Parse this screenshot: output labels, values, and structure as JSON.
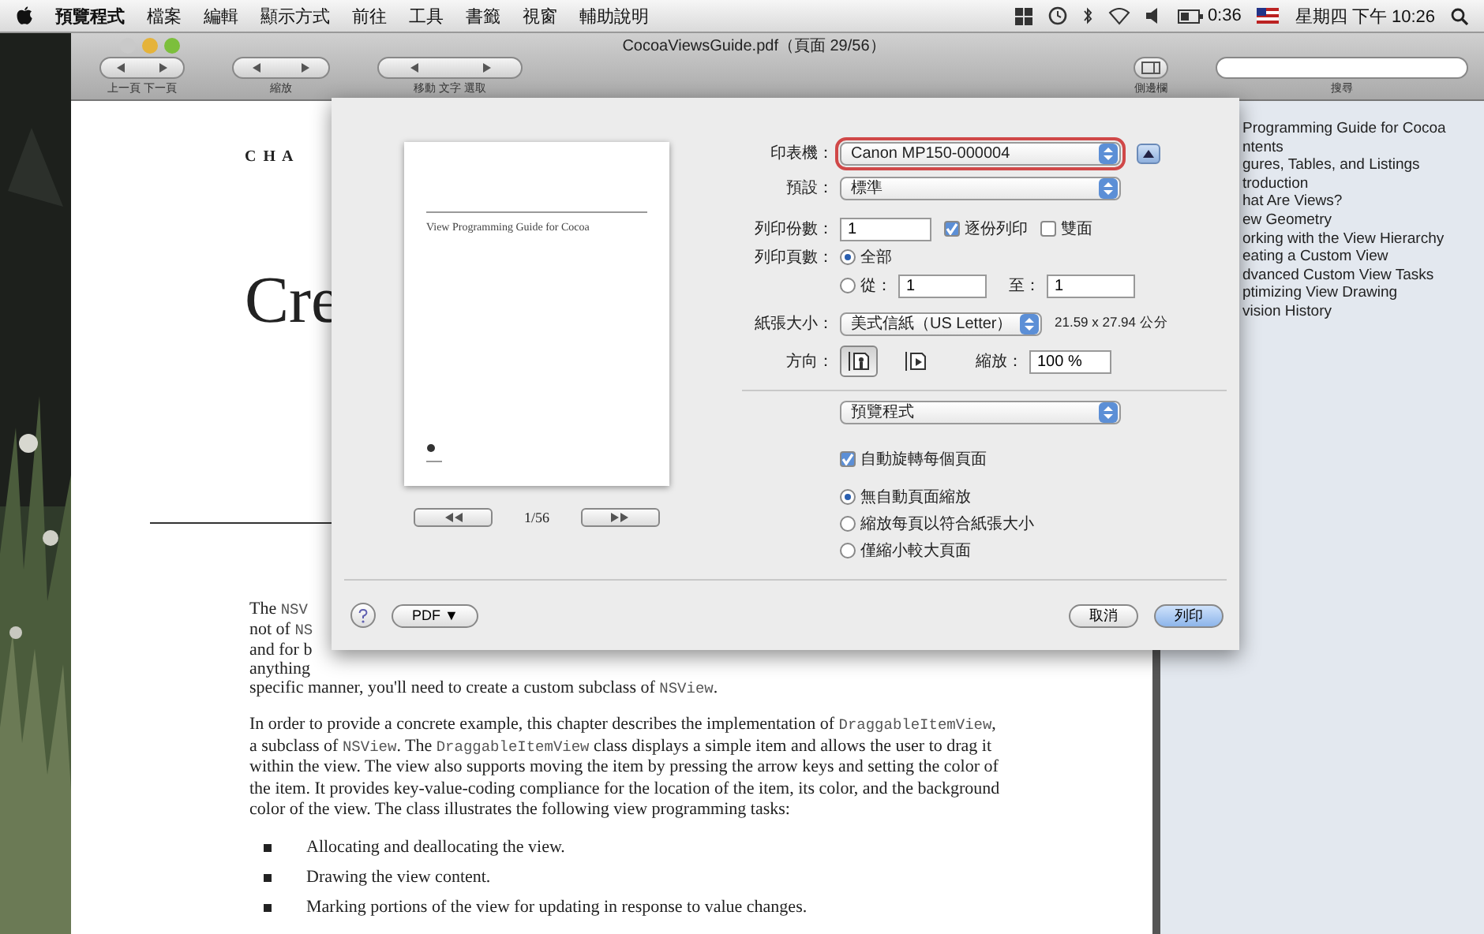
{
  "menu_bar": {
    "items": [
      "預覽程式",
      "檔案",
      "編輯",
      "顯示方式",
      "前往",
      "工具",
      "書籤",
      "視窗",
      "輔助說明"
    ],
    "battery": "0:36",
    "clock": "星期四 下午 10:26"
  },
  "window": {
    "title": "CocoaViewsGuide.pdf（頁面 29/56）"
  },
  "toolbar": {
    "labels": [
      "上一頁 下一頁",
      "縮放",
      "移動 文字 選取",
      "側邊欄",
      "搜尋"
    ]
  },
  "document": {
    "chapter": "C H A",
    "heading": "Cre",
    "intro_lines": [
      {
        "segments": [
          {
            "text": "The ",
            "code": false
          },
          {
            "text": "NSV",
            "code": true
          }
        ]
      },
      {
        "segments": [
          {
            "text": "not of ",
            "code": false
          },
          {
            "text": "NS",
            "code": true
          }
        ]
      },
      {
        "segments": [
          {
            "text": "and for b",
            "code": false
          }
        ]
      },
      {
        "segments": [
          {
            "text": "anything",
            "code": false
          }
        ]
      },
      {
        "segments": [
          {
            "text": "specific manner, you'll need to create a custom subclass of ",
            "code": false
          },
          {
            "text": "NSView",
            "code": true
          },
          {
            "text": ".",
            "code": false
          }
        ]
      }
    ],
    "paragraph": [
      {
        "text": "In order to provide a concrete example, this chapter describes the implementation of ",
        "code": false
      },
      {
        "text": "DraggableItemView",
        "code": true
      },
      {
        "text": ", a subclass of ",
        "code": false
      },
      {
        "text": "NSView",
        "code": true
      },
      {
        "text": ". The ",
        "code": false
      },
      {
        "text": "DraggableItemView",
        "code": true
      },
      {
        "text": " class displays a simple item and allows the user to drag it within the view. The view also supports moving the item by pressing the arrow keys and setting the color of the item. It provides key-value-coding compliance for the location of the item, its color, and the background color of the view. The class illustrates the following view programming tasks:",
        "code": false
      }
    ],
    "bullets": [
      "Allocating and deallocating the view.",
      "Drawing the view content.",
      "Marking portions of the view for updating in response to value changes."
    ]
  },
  "sidebar": {
    "items": [
      "Programming Guide for Cocoa",
      "ntents",
      "gures, Tables, and Listings",
      "troduction",
      "hat Are Views?",
      "ew Geometry",
      "orking with the View Hierarchy",
      "eating a Custom View",
      "dvanced Custom View Tasks",
      "ptimizing View Drawing",
      "vision History"
    ]
  },
  "print_dialog": {
    "preview": {
      "page_title": "View Programming Guide for Cocoa",
      "page_counter": "1/56"
    },
    "printer": {
      "label": "印表機：",
      "value": "Canon MP150-000004",
      "highlighted": true
    },
    "presets": {
      "label": "預設：",
      "value": "標準"
    },
    "copies": {
      "label": "列印份數：",
      "value": "1",
      "options": [
        {
          "label": "逐份列印",
          "checked": true
        },
        {
          "label": "雙面",
          "checked": false
        }
      ]
    },
    "pages": {
      "label": "列印頁數：",
      "all": {
        "label": "全部",
        "selected": true
      },
      "range": {
        "label": "從：",
        "selected": false,
        "from": "1",
        "to_label": "至：",
        "to": "1"
      }
    },
    "paper_size": {
      "label": "紙張大小：",
      "value": "美式信紙（US Letter）",
      "dimensions": "21.59 x 27.94 公分"
    },
    "orientation": {
      "label": "方向：",
      "options": [
        {
          "kind": "portrait",
          "selected": true
        },
        {
          "kind": "landscape",
          "selected": false
        }
      ],
      "scale_label": "縮放：",
      "scale": "100 %"
    },
    "section": {
      "value": "預覽程式"
    },
    "auto_rotate": {
      "label": "自動旋轉每個頁面",
      "checked": true
    },
    "scaling": [
      {
        "label": "無自動頁面縮放",
        "selected": true
      },
      {
        "label": "縮放每頁以符合紙張大小",
        "selected": false
      },
      {
        "label": "僅縮小較大頁面",
        "selected": false
      }
    ],
    "pdf_button": "PDF ▼",
    "cancel_button": "取消",
    "print_button": "列印"
  }
}
